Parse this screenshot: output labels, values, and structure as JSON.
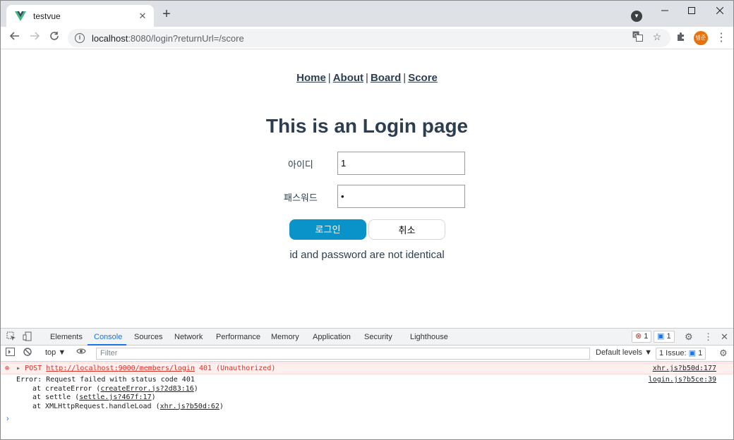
{
  "browser": {
    "tab_title": "testvue",
    "tab_close": "✕",
    "new_tab": "+",
    "url_host": "localhost",
    "url_path": ":8080/login?returnUrl=/score",
    "avatar_text": "병준",
    "icons": [
      "vue-logo-icon",
      "back-icon",
      "forward-icon",
      "reload-icon",
      "info-icon",
      "translate-icon",
      "star-icon",
      "extensions-icon",
      "menu-icon",
      "minimize-icon",
      "maximize-icon",
      "close-icon"
    ]
  },
  "page": {
    "nav": {
      "home": "Home",
      "about": "About",
      "board": "Board",
      "score": "Score",
      "sep": "|"
    },
    "heading": "This is an Login page",
    "id_label": "아이디",
    "id_value": "1",
    "password_label": "패스워드",
    "password_value": "•",
    "login_button": "로그인",
    "cancel_button": "취소",
    "error_message": "id and password are not identical"
  },
  "devtools": {
    "tabs": [
      "Elements",
      "Console",
      "Sources",
      "Network",
      "Performance",
      "Memory",
      "Application",
      "Security",
      "Lighthouse"
    ],
    "active_tab": "Console",
    "error_count": "1",
    "message_count": "1",
    "context": "top ▼",
    "filter_placeholder": "Filter",
    "default_levels": "Default levels ▼",
    "issues": "1 Issue:",
    "issues_count": "1",
    "error_line": {
      "method": "POST",
      "url": "http://localhost:9000/members/login",
      "status": "401 (Unauthorized)",
      "source": "xhr.js?b50d:177"
    },
    "trace": {
      "line1": "Error: Request failed with status code 401",
      "line1_source": "login.js?b5ce:39",
      "line2_prefix": "at createError (",
      "line2_link": "createError.js?2d83:16",
      "line3_prefix": "at settle (",
      "line3_link": "settle.js?467f:17",
      "line4_prefix": "at XMLHttpRequest.handleLoad (",
      "line4_link": "xhr.js?b50d:62",
      "close_paren": ")"
    },
    "prompt": "›"
  }
}
